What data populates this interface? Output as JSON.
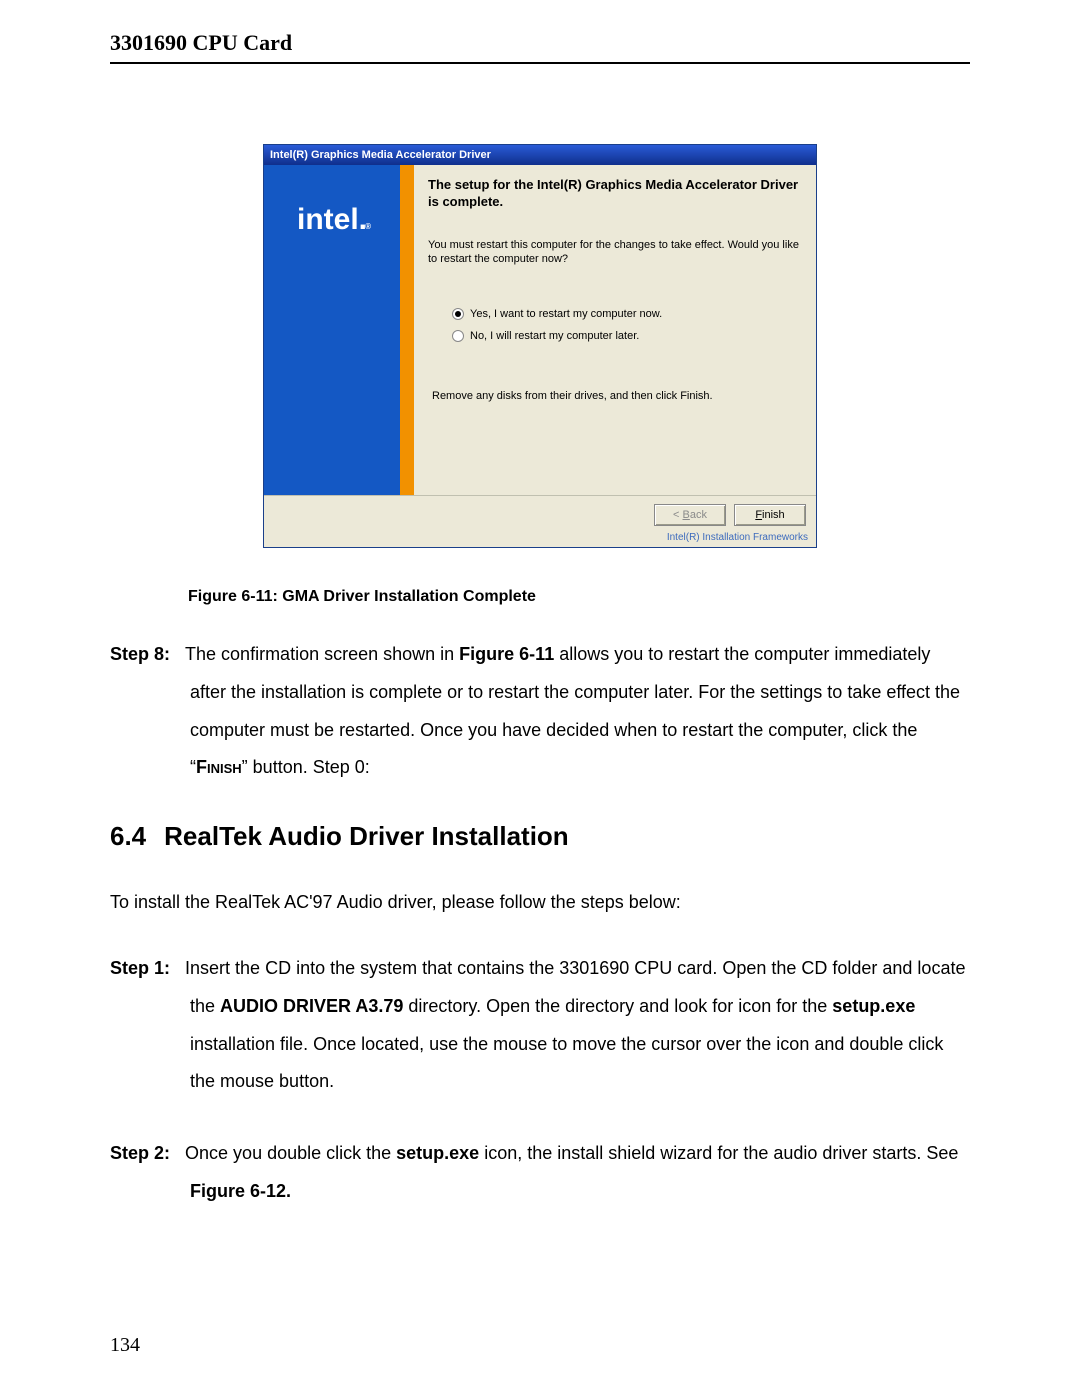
{
  "doc_header": "3301690 CPU Card",
  "installer": {
    "titlebar": "Intel(R) Graphics Media Accelerator Driver",
    "logo_text": "intel",
    "heading": "The setup for the Intel(R) Graphics Media Accelerator Driver is complete.",
    "body_text": "You must restart this computer for the changes to take effect. Would you like to restart the computer now?",
    "radio_yes": "Yes, I want to restart my computer now.",
    "radio_no": "No, I will restart my computer later.",
    "note": "Remove any disks from their drives, and then click Finish.",
    "back_prefix": "< ",
    "back_u": "B",
    "back_suffix": "ack",
    "finish_u": "F",
    "finish_suffix": "inish",
    "framework": "Intel(R) Installation Frameworks"
  },
  "caption": "Figure 6-11: GMA Driver Installation Complete",
  "step8": {
    "label": "Step 8:",
    "t1": "The confirmation screen shown in ",
    "fig_ref": "Figure 6-11",
    "t2": " allows you to restart the computer immediately after the installation is complete or to restart the computer later. For the settings to take effect the computer must be restarted. Once you have decided when to restart the computer, click the “",
    "finish_word": "Finish",
    "t3": "” button.  Step 0:"
  },
  "section": {
    "num": "6.4",
    "title": "RealTek Audio Driver Installation"
  },
  "intro": "To install the RealTek AC'97 Audio driver, please follow the steps below:",
  "step1": {
    "label": "Step 1:",
    "t1": "Insert the CD into the system that contains the 3301690 CPU card. Open the CD folder and locate the ",
    "dir": "AUDIO DRIVER A3.79",
    "t2": " directory. Open the directory and look for icon for the ",
    "exe": "setup.exe",
    "t3": " installation file. Once located, use the mouse to move the cursor over the icon and double click the mouse button."
  },
  "step2": {
    "label": "Step 2:",
    "t1": "Once you double click the ",
    "exe": "setup.exe",
    "t2": " icon, the install shield wizard for the audio driver starts. See ",
    "fig_ref": "Figure 6-12."
  },
  "page_number": "134"
}
